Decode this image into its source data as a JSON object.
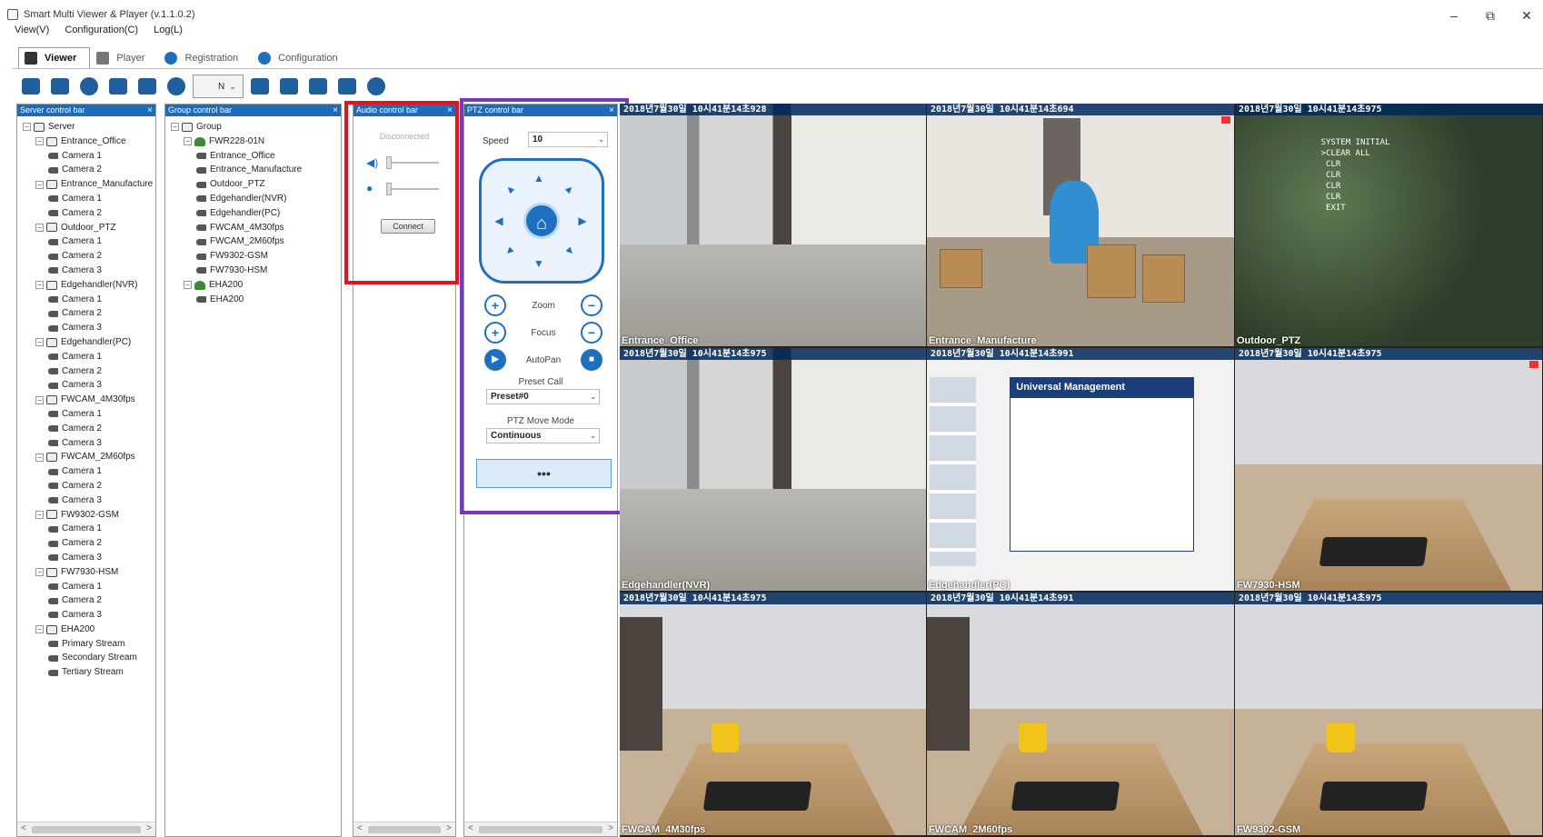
{
  "window": {
    "title": "Smart Multi Viewer & Player (v.1.1.0.2)",
    "controls": [
      "–",
      "⧉",
      "✕"
    ]
  },
  "menubar": [
    "View(V)",
    "Configuration(C)",
    "Log(L)"
  ],
  "tabs": [
    {
      "label": "Viewer",
      "active": true
    },
    {
      "label": "Player",
      "active": false
    },
    {
      "label": "Registration",
      "active": false
    },
    {
      "label": "Configuration",
      "active": false
    }
  ],
  "toolbar": {
    "layout_label": "N"
  },
  "server_panel": {
    "title": "Server control bar",
    "rows": [
      {
        "label": "Server",
        "level": 0,
        "kind": "root"
      },
      {
        "label": "Entrance_Office",
        "level": 1,
        "kind": "node"
      },
      {
        "label": "Camera 1",
        "level": 2,
        "kind": "cam"
      },
      {
        "label": "Camera 2",
        "level": 2,
        "kind": "cam"
      },
      {
        "label": "Entrance_Manufacture",
        "level": 1,
        "kind": "node"
      },
      {
        "label": "Camera 1",
        "level": 2,
        "kind": "cam"
      },
      {
        "label": "Camera 2",
        "level": 2,
        "kind": "cam"
      },
      {
        "label": "Outdoor_PTZ",
        "level": 1,
        "kind": "node"
      },
      {
        "label": "Camera 1",
        "level": 2,
        "kind": "cam"
      },
      {
        "label": "Camera 2",
        "level": 2,
        "kind": "cam"
      },
      {
        "label": "Camera 3",
        "level": 2,
        "kind": "cam"
      },
      {
        "label": "Edgehandler(NVR)",
        "level": 1,
        "kind": "node"
      },
      {
        "label": "Camera 1",
        "level": 2,
        "kind": "cam"
      },
      {
        "label": "Camera 2",
        "level": 2,
        "kind": "cam"
      },
      {
        "label": "Camera 3",
        "level": 2,
        "kind": "cam"
      },
      {
        "label": "Edgehandler(PC)",
        "level": 1,
        "kind": "node"
      },
      {
        "label": "Camera 1",
        "level": 2,
        "kind": "cam"
      },
      {
        "label": "Camera 2",
        "level": 2,
        "kind": "cam"
      },
      {
        "label": "Camera 3",
        "level": 2,
        "kind": "cam"
      },
      {
        "label": "FWCAM_4M30fps",
        "level": 1,
        "kind": "node"
      },
      {
        "label": "Camera 1",
        "level": 2,
        "kind": "cam"
      },
      {
        "label": "Camera 2",
        "level": 2,
        "kind": "cam"
      },
      {
        "label": "Camera 3",
        "level": 2,
        "kind": "cam"
      },
      {
        "label": "FWCAM_2M60fps",
        "level": 1,
        "kind": "node"
      },
      {
        "label": "Camera 1",
        "level": 2,
        "kind": "cam"
      },
      {
        "label": "Camera 2",
        "level": 2,
        "kind": "cam"
      },
      {
        "label": "Camera 3",
        "level": 2,
        "kind": "cam"
      },
      {
        "label": "FW9302-GSM",
        "level": 1,
        "kind": "node"
      },
      {
        "label": "Camera 1",
        "level": 2,
        "kind": "cam"
      },
      {
        "label": "Camera 2",
        "level": 2,
        "kind": "cam"
      },
      {
        "label": "Camera 3",
        "level": 2,
        "kind": "cam"
      },
      {
        "label": "FW7930-HSM",
        "level": 1,
        "kind": "node"
      },
      {
        "label": "Camera 1",
        "level": 2,
        "kind": "cam"
      },
      {
        "label": "Camera 2",
        "level": 2,
        "kind": "cam"
      },
      {
        "label": "Camera 3",
        "level": 2,
        "kind": "cam"
      },
      {
        "label": "EHA200",
        "level": 1,
        "kind": "node"
      },
      {
        "label": "Primary Stream",
        "level": 2,
        "kind": "cam"
      },
      {
        "label": "Secondary Stream",
        "level": 2,
        "kind": "cam"
      },
      {
        "label": "Tertiary Stream",
        "level": 2,
        "kind": "cam"
      }
    ]
  },
  "group_panel": {
    "title": "Group control bar",
    "rows": [
      {
        "label": "Group",
        "level": 0,
        "kind": "root"
      },
      {
        "label": "FWR228-01N",
        "level": 1,
        "kind": "grp"
      },
      {
        "label": "Entrance_Office",
        "level": 2,
        "kind": "cam"
      },
      {
        "label": "Entrance_Manufacture",
        "level": 2,
        "kind": "cam"
      },
      {
        "label": "Outdoor_PTZ",
        "level": 2,
        "kind": "cam"
      },
      {
        "label": "Edgehandler(NVR)",
        "level": 2,
        "kind": "cam"
      },
      {
        "label": "Edgehandler(PC)",
        "level": 2,
        "kind": "cam"
      },
      {
        "label": "FWCAM_4M30fps",
        "level": 2,
        "kind": "cam"
      },
      {
        "label": "FWCAM_2M60fps",
        "level": 2,
        "kind": "cam"
      },
      {
        "label": "FW9302-GSM",
        "level": 2,
        "kind": "cam"
      },
      {
        "label": "FW7930-HSM",
        "level": 2,
        "kind": "cam"
      },
      {
        "label": "EHA200",
        "level": 1,
        "kind": "grp"
      },
      {
        "label": "EHA200",
        "level": 2,
        "kind": "cam"
      }
    ]
  },
  "audio_panel": {
    "title": "Audio control bar",
    "status": "Disconnected",
    "connect_label": "Connect"
  },
  "ptz_panel": {
    "title": "PTZ control bar",
    "speed_label": "Speed",
    "speed_value": "10",
    "zoom_label": "Zoom",
    "focus_label": "Focus",
    "autopan_label": "AutoPan",
    "preset_call_label": "Preset Call",
    "preset_value": "Preset#0",
    "move_mode_label": "PTZ Move Mode",
    "move_mode_value": "Continuous",
    "more_label": "•••"
  },
  "video_tiles": [
    {
      "timestamp": "2018년7월30일 10시41분14초928",
      "name": "Entrance_Office",
      "scene": "hall"
    },
    {
      "timestamp": "2018년7월30일 10시41분14초694",
      "name": "Entrance_Manufacture",
      "scene": "office"
    },
    {
      "timestamp": "2018년7월30일 10시41분14초975",
      "name": "Outdoor_PTZ",
      "scene": "outdoor"
    },
    {
      "timestamp": "2018년7월30일 10시41분14초975",
      "name": "Edgehandler(NVR)",
      "scene": "hall"
    },
    {
      "timestamp": "2018년7월30일 10시41분14초991",
      "name": "Edgehandler(PC)",
      "scene": "screen"
    },
    {
      "timestamp": "2018년7월30일 10시41분14초975",
      "name": "FW7930-HSM",
      "scene": "room"
    },
    {
      "timestamp": "2018년7월30일 10시41분14초975",
      "name": "FWCAM_4M30fps",
      "scene": "room"
    },
    {
      "timestamp": "2018년7월30일 10시41분14초991",
      "name": "FWCAM_2M60fps",
      "scene": "room"
    },
    {
      "timestamp": "2018년7월30일 10시41분14초975",
      "name": "FW9302-GSM",
      "scene": "room"
    }
  ],
  "screen_share": {
    "slide_title": "Universal Management"
  },
  "osd": {
    "text": "SYSTEM INITIAL\n>CLEAR ALL\n CLR\n CLR\n CLR\n CLR\n EXIT"
  },
  "colors": {
    "accent": "#1f6fc0",
    "panel_header": "#1e6bb8",
    "highlight_red": "#e3141a",
    "highlight_purple": "#7a3ab8"
  }
}
